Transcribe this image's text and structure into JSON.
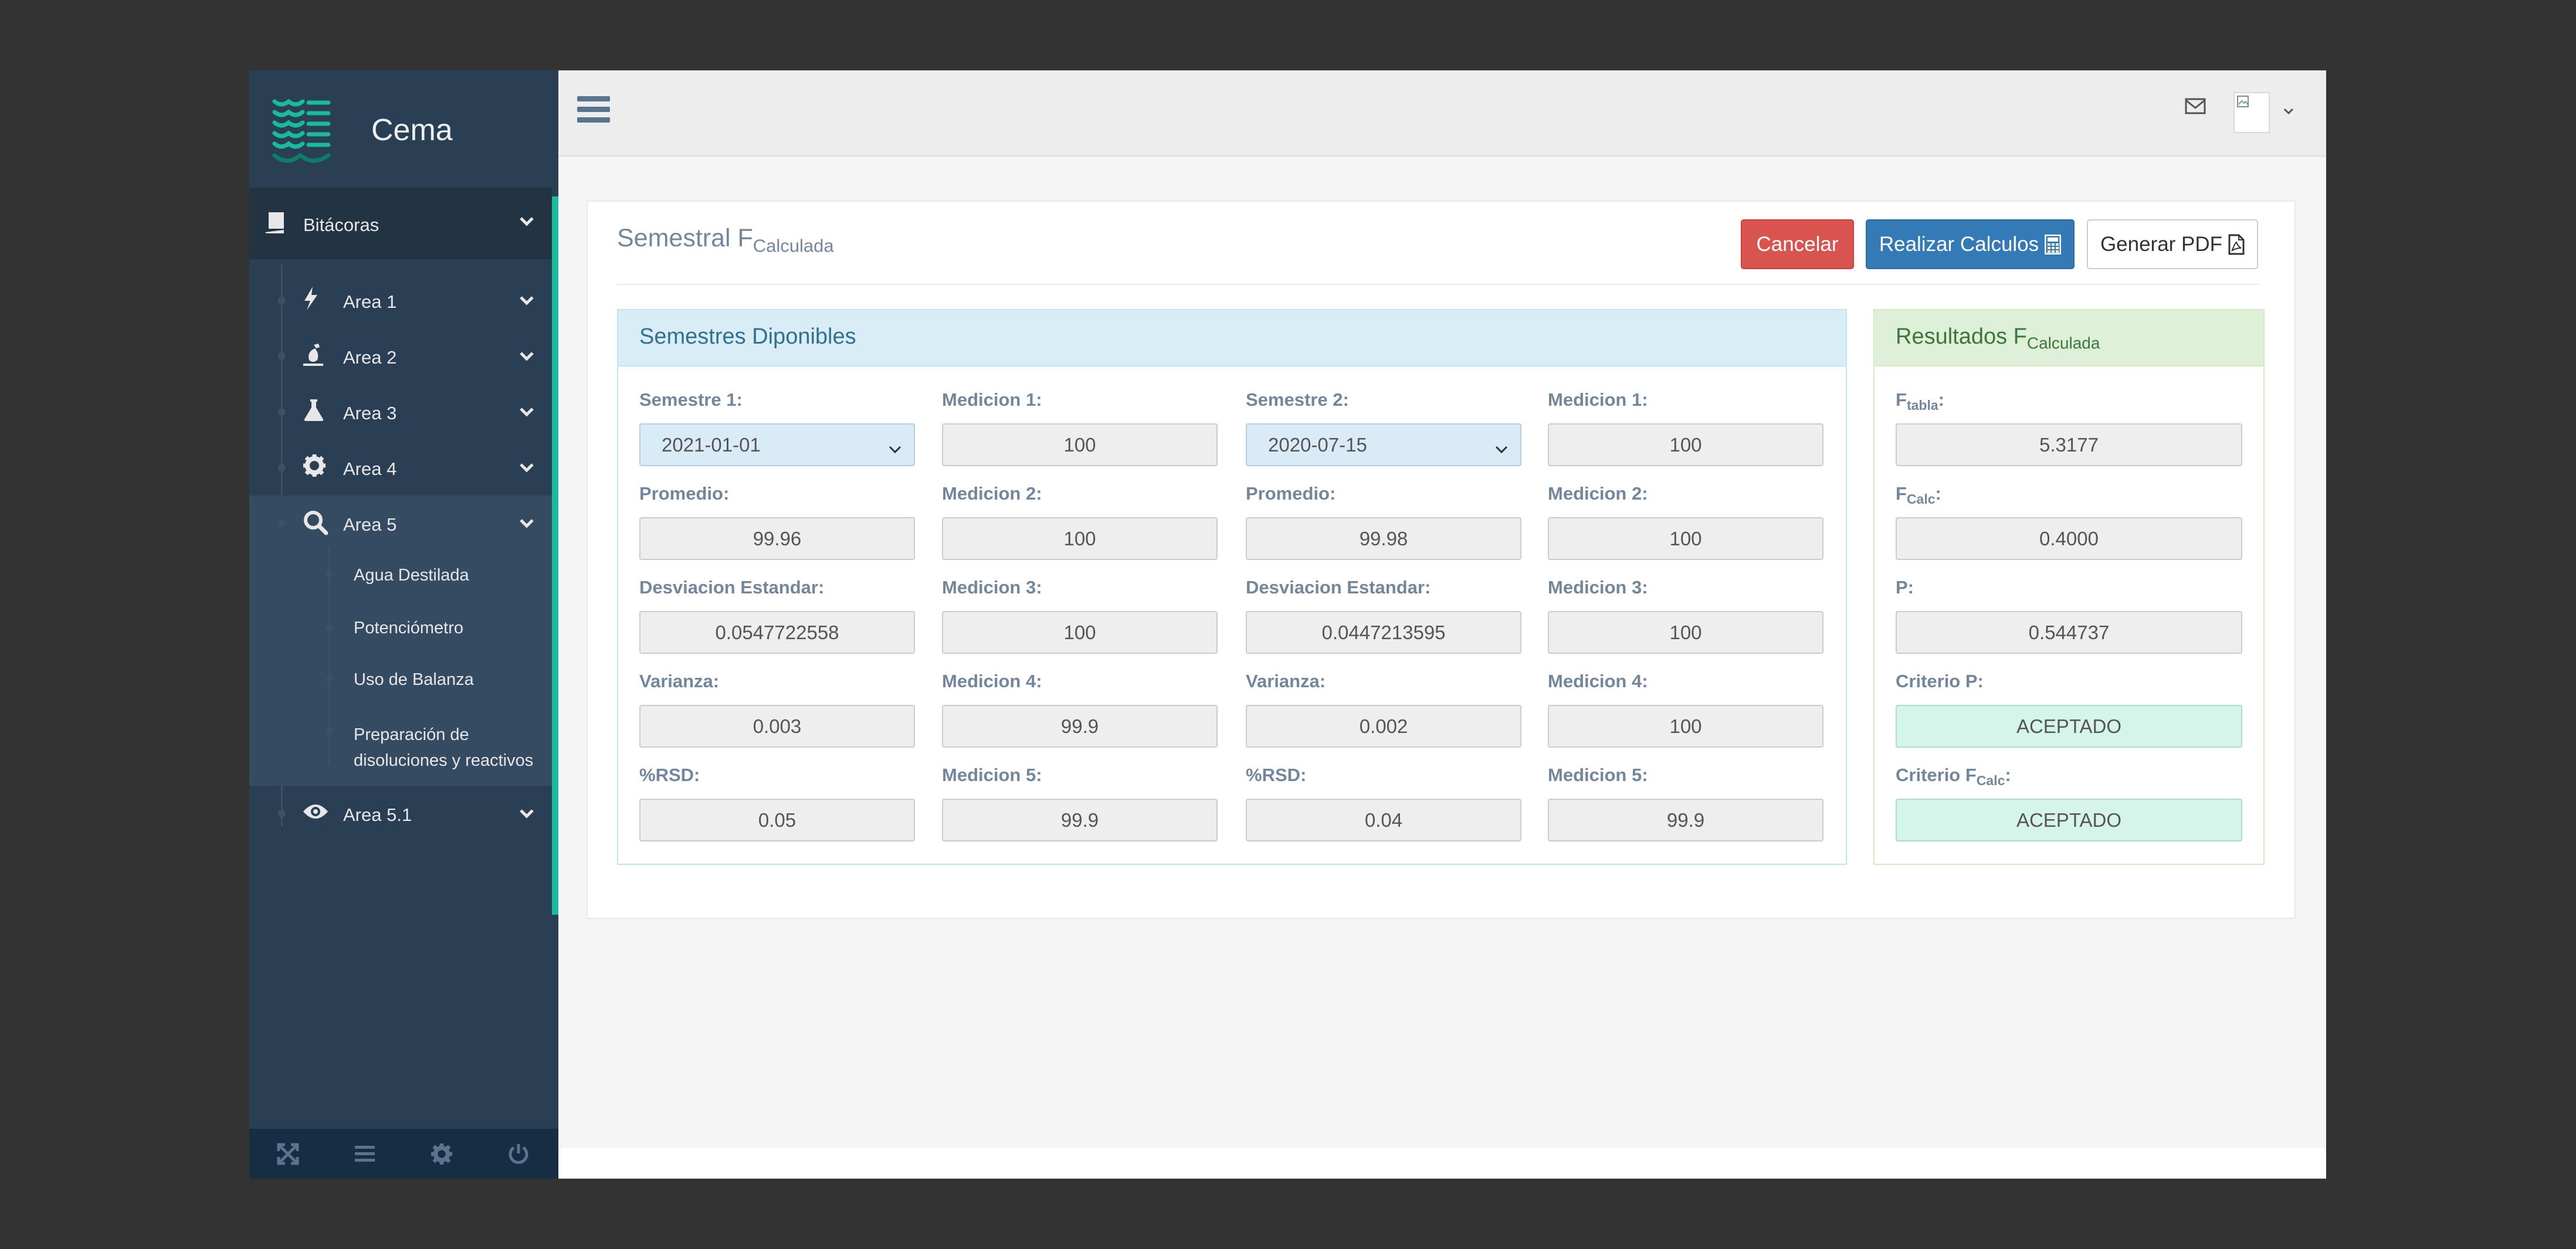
{
  "brand": {
    "name": "Cema"
  },
  "sidebar": {
    "section": {
      "label": "Bitácoras",
      "icon": "book-icon"
    },
    "areas": [
      {
        "label": "Area 1",
        "icon": "bolt-icon"
      },
      {
        "label": "Area 2",
        "icon": "flask-icon"
      },
      {
        "label": "Area 3",
        "icon": "beaker-icon"
      },
      {
        "label": "Area 4",
        "icon": "gear-icon"
      },
      {
        "label": "Area 5",
        "icon": "search-icon"
      },
      {
        "label": "Area 5.1",
        "icon": "eye-icon"
      }
    ],
    "area5_items": [
      {
        "label": "Agua Destilada"
      },
      {
        "label": "Potenciómetro"
      },
      {
        "label": "Uso de Balanza"
      },
      {
        "label": "Preparación de disoluciones y reactivos"
      }
    ],
    "footer_icons": [
      "fullscreen-icon",
      "list-icon",
      "gear-icon",
      "power-icon"
    ]
  },
  "topnav": {
    "menu_icon": "hamburger-icon",
    "mail_icon": "mail-icon"
  },
  "page": {
    "title": "Semestral F",
    "title_sub": "Calculada",
    "buttons": {
      "cancel": "Cancelar",
      "calc": "Realizar Calculos",
      "pdf": "Generar PDF"
    }
  },
  "semestres": {
    "title": "Semestres Diponibles",
    "sem1": {
      "label": "Semestre 1:",
      "value": "2021-01-01",
      "promedio_label": "Promedio:",
      "promedio": "99.96",
      "desv_label": "Desviacion Estandar:",
      "desv": "0.0547722558",
      "var_label": "Varianza:",
      "var": "0.003",
      "rsd_label": "%RSD:",
      "rsd": "0.05",
      "mediciones": [
        {
          "label": "Medicion 1:",
          "value": "100"
        },
        {
          "label": "Medicion 2:",
          "value": "100"
        },
        {
          "label": "Medicion 3:",
          "value": "100"
        },
        {
          "label": "Medicion 4:",
          "value": "99.9"
        },
        {
          "label": "Medicion 5:",
          "value": "99.9"
        }
      ]
    },
    "sem2": {
      "label": "Semestre 2:",
      "value": "2020-07-15",
      "promedio_label": "Promedio:",
      "promedio": "99.98",
      "desv_label": "Desviacion Estandar:",
      "desv": "0.0447213595",
      "var_label": "Varianza:",
      "var": "0.002",
      "rsd_label": "%RSD:",
      "rsd": "0.04",
      "mediciones": [
        {
          "label": "Medicion 1:",
          "value": "100"
        },
        {
          "label": "Medicion 2:",
          "value": "100"
        },
        {
          "label": "Medicion 3:",
          "value": "100"
        },
        {
          "label": "Medicion 4:",
          "value": "100"
        },
        {
          "label": "Medicion 5:",
          "value": "99.9"
        }
      ]
    }
  },
  "resultados": {
    "title": "Resultados F",
    "title_sub": "Calculada",
    "ftabla_label": "F",
    "ftabla_sub": "tabla",
    "ftabla": "5.3177",
    "fcalc_label": "F",
    "fcalc_sub": "Calc",
    "fcalc": "0.4000",
    "p_label": "P:",
    "p": "0.544737",
    "criterio_p_label": "Criterio P:",
    "criterio_p": "ACEPTADO",
    "criterio_f_label": "Criterio F",
    "criterio_f_sub": "Calc",
    "criterio_f": "ACEPTADO"
  },
  "colors": {
    "sidebar": "#2a3f54",
    "accent": "#1abb9c",
    "danger": "#d9534f",
    "primary": "#337ab7"
  }
}
